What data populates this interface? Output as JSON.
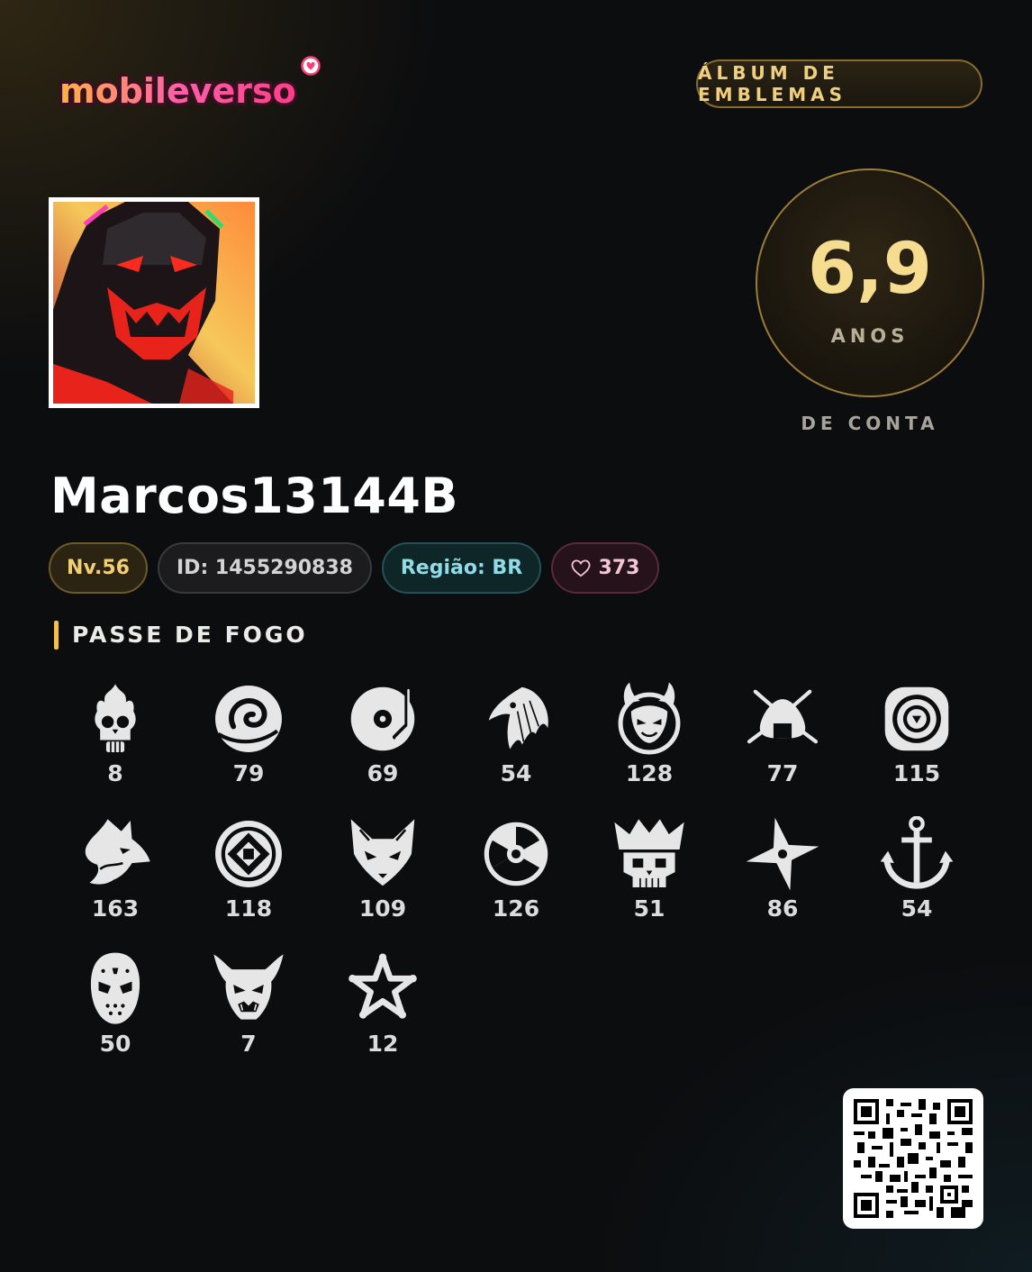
{
  "brand": {
    "logo_text": "mobileverso",
    "logo_icon": "heart-check-icon"
  },
  "header": {
    "album_button_label": "ÁLBUM DE EMBLEMAS"
  },
  "account_age": {
    "value": "6,9",
    "unit": "ANOS",
    "caption": "DE CONTA"
  },
  "profile": {
    "username": "Marcos13144B",
    "level": "Nv.56",
    "id": "ID: 1455290838",
    "region": "Região: BR",
    "likes": "373",
    "likes_icon": "heart-outline-icon"
  },
  "fire_pass": {
    "title": "PASSE DE FOGO",
    "badges": [
      {
        "icon": "flaming-skull-icon",
        "count": "8"
      },
      {
        "icon": "swirl-cloud-icon",
        "count": "79"
      },
      {
        "icon": "turntable-icon",
        "count": "69"
      },
      {
        "icon": "eagle-head-icon",
        "count": "54"
      },
      {
        "icon": "devil-horns-icon",
        "count": "128"
      },
      {
        "icon": "rice-ball-crossed-icon",
        "count": "77"
      },
      {
        "icon": "target-ring-icon",
        "count": "115"
      },
      {
        "icon": "wolf-head-icon",
        "count": "163"
      },
      {
        "icon": "ancient-coin-icon",
        "count": "118"
      },
      {
        "icon": "fox-head-icon",
        "count": "109"
      },
      {
        "icon": "radiation-icon",
        "count": "126"
      },
      {
        "icon": "crowned-skull-icon",
        "count": "51"
      },
      {
        "icon": "shuriken-icon",
        "count": "86"
      },
      {
        "icon": "anchor-icon",
        "count": "54"
      },
      {
        "icon": "hockey-mask-icon",
        "count": "50"
      },
      {
        "icon": "oni-mask-icon",
        "count": "7"
      },
      {
        "icon": "sheriff-star-icon",
        "count": "12"
      }
    ]
  },
  "qr_code": {
    "icon": "qr-code-icon"
  },
  "colors": {
    "gold": "#f2c14e",
    "gold_text": "#f5dc8e",
    "region_cyan": "#8fdbe6",
    "likes_pink": "#f2c6d2",
    "background": "#0c0d0f"
  }
}
